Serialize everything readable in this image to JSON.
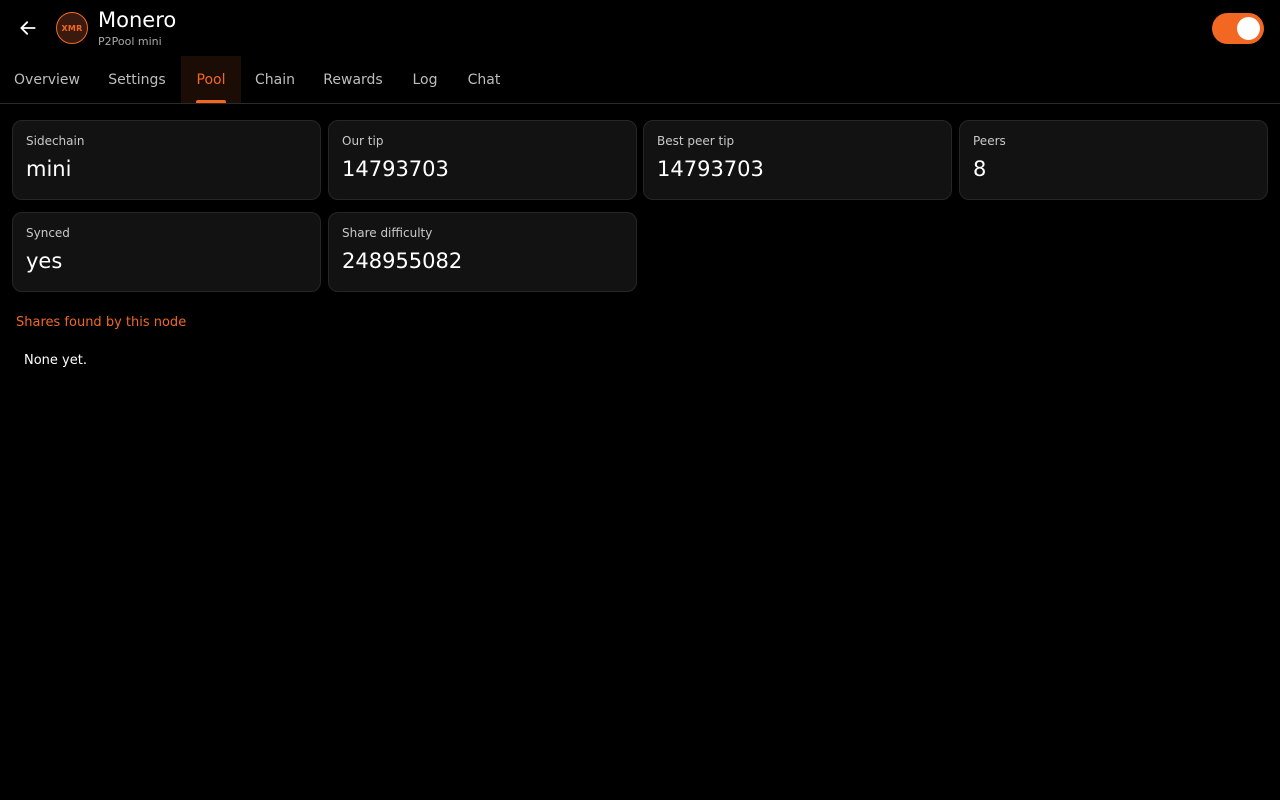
{
  "header": {
    "title": "Monero",
    "subtitle": "P2Pool mini",
    "coin_badge": "XMR",
    "back_icon": "arrow-left-icon",
    "toggle_on": true
  },
  "tabs": [
    {
      "label": "Overview",
      "active": false
    },
    {
      "label": "Settings",
      "active": false
    },
    {
      "label": "Pool",
      "active": true
    },
    {
      "label": "Chain",
      "active": false
    },
    {
      "label": "Rewards",
      "active": false
    },
    {
      "label": "Log",
      "active": false
    },
    {
      "label": "Chat",
      "active": false
    }
  ],
  "stats": [
    {
      "label": "Sidechain",
      "value": "mini"
    },
    {
      "label": "Our tip",
      "value": "14793703"
    },
    {
      "label": "Best peer tip",
      "value": "14793703"
    },
    {
      "label": "Peers",
      "value": "8"
    },
    {
      "label": "Synced",
      "value": "yes"
    },
    {
      "label": "Share difficulty",
      "value": "248955082"
    }
  ],
  "shares": {
    "title": "Shares found by this node",
    "empty_text": "None yet."
  },
  "colors": {
    "accent": "#f26822",
    "background": "#000000",
    "card": "#121212"
  }
}
